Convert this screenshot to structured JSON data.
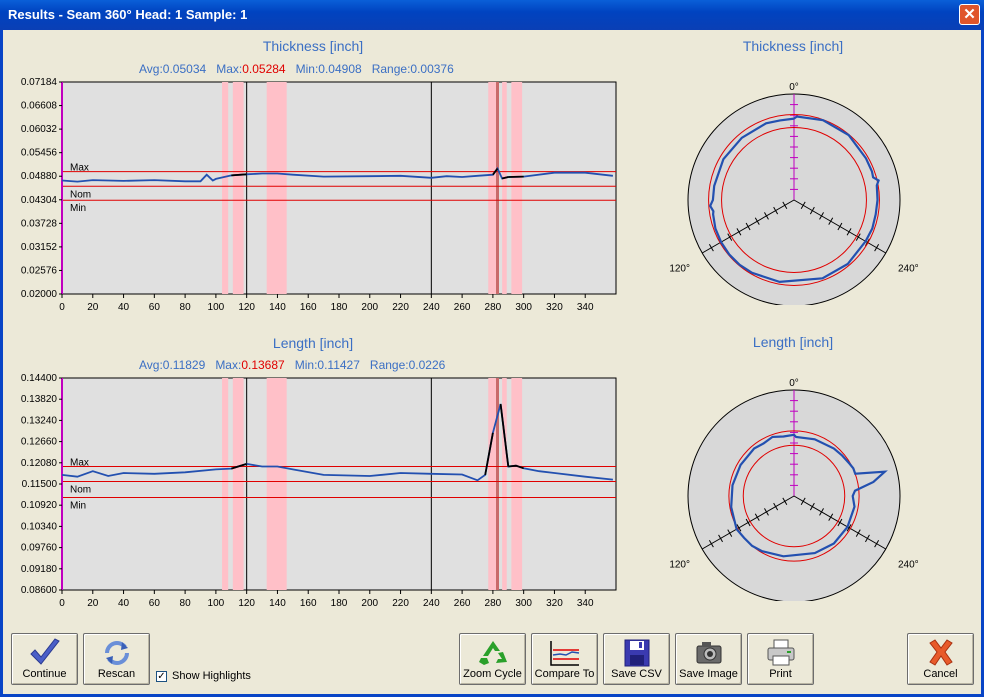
{
  "window": {
    "title": "Results - Seam 360° Head: 1  Sample: 1",
    "close_glyph": "✕"
  },
  "thickness_chart": {
    "title": "Thickness [inch]",
    "avg_label": "Avg:",
    "avg": "0.05034",
    "max_label": "Max:",
    "max": "0.05284",
    "min_label": "Min:",
    "min": "0.04908",
    "range_label": "Range:",
    "range": "0.00376",
    "y_ticks": [
      "0.07184",
      "0.06608",
      "0.06032",
      "0.05456",
      "0.04880",
      "0.04304",
      "0.03728",
      "0.03152",
      "0.02576",
      "0.02000"
    ],
    "x_ticks": [
      "0",
      "20",
      "40",
      "60",
      "80",
      "100",
      "120",
      "140",
      "160",
      "180",
      "200",
      "220",
      "240",
      "260",
      "280",
      "300",
      "320",
      "340"
    ],
    "ref_lines": [
      "Max",
      "Nom",
      "Min"
    ]
  },
  "length_chart": {
    "title": "Length [inch]",
    "avg_label": "Avg:",
    "avg": "0.11829",
    "max_label": "Max:",
    "max": "0.13687",
    "min_label": "Min:",
    "min": "0.11427",
    "range_label": "Range:",
    "range": "0.0226",
    "y_ticks": [
      "0.14400",
      "0.13820",
      "0.13240",
      "0.12660",
      "0.12080",
      "0.11500",
      "0.10920",
      "0.10340",
      "0.09760",
      "0.09180",
      "0.08600"
    ],
    "x_ticks": [
      "0",
      "20",
      "40",
      "60",
      "80",
      "100",
      "120",
      "140",
      "160",
      "180",
      "200",
      "220",
      "240",
      "260",
      "280",
      "300",
      "320",
      "340"
    ],
    "ref_lines": [
      "Max",
      "Nom",
      "Min"
    ]
  },
  "polar_thickness": {
    "title": "Thickness [inch]",
    "labels": [
      "0°",
      "120°",
      "240°"
    ]
  },
  "polar_length": {
    "title": "Length [inch]",
    "labels": [
      "0°",
      "120°",
      "240°"
    ]
  },
  "chart_data": [
    {
      "type": "line",
      "title": "Thickness [inch]",
      "xlabel": "",
      "ylabel": "",
      "xlim": [
        0,
        360
      ],
      "ylim": [
        0.02,
        0.07472
      ],
      "ref_lines": {
        "Max": 0.0516,
        "Nom": 0.0478,
        "Min": 0.0442
      },
      "highlight_bands": [
        [
          104,
          108
        ],
        [
          111,
          118
        ],
        [
          133,
          146
        ],
        [
          277,
          282
        ],
        [
          286,
          289
        ],
        [
          292,
          299
        ]
      ],
      "markers": [
        120,
        240,
        283
      ],
      "series": [
        {
          "x": [
            0,
            10,
            20,
            40,
            60,
            80,
            90,
            94,
            98,
            100,
            110,
            120,
            130,
            140,
            150,
            170,
            200,
            220,
            240,
            250,
            260,
            270,
            280,
            283,
            286,
            290,
            300,
            320,
            340,
            358
          ],
          "values": [
            0.0493,
            0.049,
            0.0494,
            0.0492,
            0.0494,
            0.0491,
            0.0491,
            0.0508,
            0.0493,
            0.0497,
            0.0506,
            0.0509,
            0.0511,
            0.0511,
            0.0508,
            0.0503,
            0.0504,
            0.0505,
            0.05,
            0.0504,
            0.0502,
            0.0505,
            0.0508,
            0.0524,
            0.0498,
            0.0502,
            0.0503,
            0.0513,
            0.0513,
            0.0505
          ]
        }
      ]
    },
    {
      "type": "line",
      "title": "Length [inch]",
      "xlabel": "",
      "ylabel": "",
      "xlim": [
        0,
        360
      ],
      "ylim": [
        0.086,
        0.144
      ],
      "ref_lines": {
        "Max": 0.1198,
        "Nom": 0.1157,
        "Min": 0.1113
      },
      "highlight_bands": [
        [
          104,
          108
        ],
        [
          111,
          118
        ],
        [
          133,
          146
        ],
        [
          277,
          282
        ],
        [
          286,
          289
        ],
        [
          292,
          299
        ]
      ],
      "markers": [
        120,
        240,
        283
      ],
      "series": [
        {
          "x": [
            0,
            10,
            20,
            30,
            40,
            60,
            80,
            100,
            110,
            120,
            130,
            140,
            150,
            170,
            200,
            220,
            240,
            260,
            270,
            275,
            280,
            285,
            290,
            295,
            300,
            310,
            320,
            340,
            358
          ],
          "values": [
            0.1175,
            0.117,
            0.1185,
            0.1172,
            0.118,
            0.1178,
            0.1182,
            0.119,
            0.1192,
            0.1205,
            0.1198,
            0.1198,
            0.119,
            0.1175,
            0.1172,
            0.118,
            0.1178,
            0.1176,
            0.116,
            0.1175,
            0.129,
            0.1369,
            0.1198,
            0.12,
            0.1193,
            0.1185,
            0.118,
            0.117,
            0.1162
          ]
        }
      ]
    }
  ],
  "buttons": {
    "continue": "Continue",
    "rescan": "Rescan",
    "show_highlights": "Show Highlights",
    "zoom_cycle": "Zoom Cycle",
    "compare_to": "Compare To",
    "save_csv": "Save CSV",
    "save_image": "Save Image",
    "print": "Print",
    "cancel": "Cancel"
  },
  "checkbox": {
    "checked": true,
    "glyph": "✓"
  },
  "icons": {
    "continue": "checkmark-icon",
    "rescan": "refresh-icon",
    "zoom_cycle": "recycle-icon",
    "compare_to": "chart-compare-icon",
    "save_csv": "floppy-disk-icon",
    "save_image": "camera-icon",
    "print": "printer-icon",
    "cancel": "cancel-x-icon"
  },
  "colors": {
    "series": "#2350b0",
    "highlight": "#ffc0c8",
    "ref_line": "#e00000",
    "plot_bg": "#e0e0e0",
    "title": "#3b6fc4"
  }
}
